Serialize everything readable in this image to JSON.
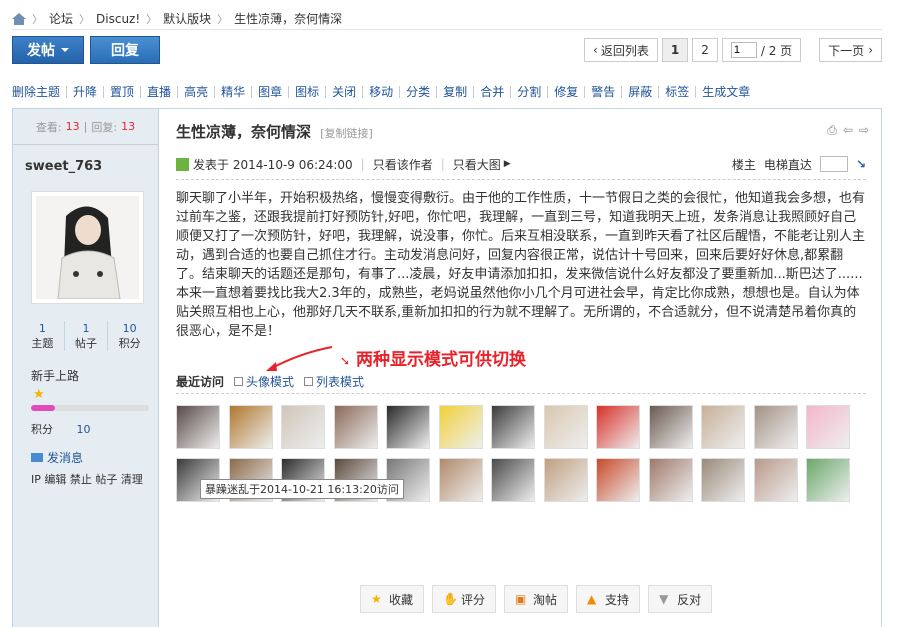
{
  "breadcrumb": [
    "论坛",
    "Discuz!",
    "默认版块",
    "生性凉薄，奈何情深"
  ],
  "toolbar": {
    "post_label": "发帖",
    "reply_label": "回复"
  },
  "pager": {
    "back_label": "返回列表",
    "pages": [
      "1",
      "2"
    ],
    "current": "1",
    "total": "/ 2 页",
    "next_label": "下一页"
  },
  "admin_actions": [
    "删除主题",
    "升降",
    "置顶",
    "直播",
    "高亮",
    "精华",
    "图章",
    "图标",
    "关闭",
    "移动",
    "分类",
    "复制",
    "合并",
    "分割",
    "修复",
    "警告",
    "屏蔽",
    "标签",
    "生成文章"
  ],
  "sidebar": {
    "views_label": "查看:",
    "views": "13",
    "replies_label": "回复:",
    "replies": "13",
    "username": "sweet_763",
    "counts": [
      {
        "value": "1",
        "label": "主题"
      },
      {
        "value": "1",
        "label": "帖子"
      },
      {
        "value": "10",
        "label": "积分"
      }
    ],
    "rank": "新手上路",
    "rank_progress": 0.2,
    "credits_label": "积分",
    "credits": "10",
    "send_msg": "发消息",
    "ops": "IP 编辑 禁止 帖子 清理"
  },
  "post": {
    "title": "生性凉薄，奈何情深",
    "copy_link": "[复制链接]",
    "posted": "发表于 2014-10-9 06:24:00",
    "author_only": "只看该作者",
    "large_image": "只看大图",
    "floor_label": "楼主",
    "goto_label": "电梯直达",
    "body": "聊天聊了小半年，开始积极热络，慢慢变得敷衍。由于他的工作性质，十一节假日之类的会很忙，他知道我会多想，也有过前车之鉴，还跟我提前打好预防针,好吧，你忙吧，我理解，一直到三号，知道我明天上班，发条消息让我照顾好自己顺便又打了一次预防针，好吧，我理解，说没事，你忙。后来互相没联系，一直到昨天看了社区后醒悟，不能老让别人主动，遇到合适的也要自己抓住才行。主动发消息问好，回复内容很正常，说估计十号回来，回来后要好好休息,都累翻了。结束聊天的话题还是那句，有事了...凌晨，好友申请添加扣扣，发来微信说什么好友都没了要重新加...斯巴达了......本来一直想着要找比我大2.3年的，成熟些，老妈说虽然他你小几个月可进社会早，肯定比你成熟，想想也是。自认为体贴关照互相也上心，他那好几天不联系,重新加扣扣的行为就不理解了。无所谓的，不合适就分，但不说清楚吊着你真的很恶心，是不是！"
  },
  "annotation": "两种显示模式可供切换",
  "visits": {
    "heading": "最近访问",
    "avatar_mode": "头像模式",
    "list_mode": "列表模式"
  },
  "thumb_colors": [
    "#5a4a48",
    "#b0782e",
    "#cfc6b8",
    "#8b6a5a",
    "#2a2a2a",
    "#f0d23a",
    "#3b3b3b",
    "#d9c7b0",
    "#d7312a",
    "#6a5a50",
    "#c8b09a",
    "#a39386",
    "#f3b6cc",
    "#3a3a3a",
    "#8c6a4a",
    "#2c2c2c",
    "#5c4a3c",
    "#777",
    "#b08a6a",
    "#4a4a4a",
    "#c0a080",
    "#c84a2a",
    "#a07a6a",
    "#9a8a7a",
    "#b89a8a",
    "#6aa86a"
  ],
  "tooltip": "暴躁迷乱于2014-10-21 16:13:20访问",
  "actions": [
    {
      "label": "收藏",
      "icon": "star-icon",
      "color": "#f4b400"
    },
    {
      "label": "评分",
      "icon": "rate-icon",
      "color": "#d98a4a"
    },
    {
      "label": "淘帖",
      "icon": "collect-icon",
      "color": "#e37a1a"
    },
    {
      "label": "支持",
      "icon": "thumb-up-icon",
      "color": "#f08a00"
    },
    {
      "label": "反对",
      "icon": "thumb-down-icon",
      "color": "#999999"
    }
  ]
}
